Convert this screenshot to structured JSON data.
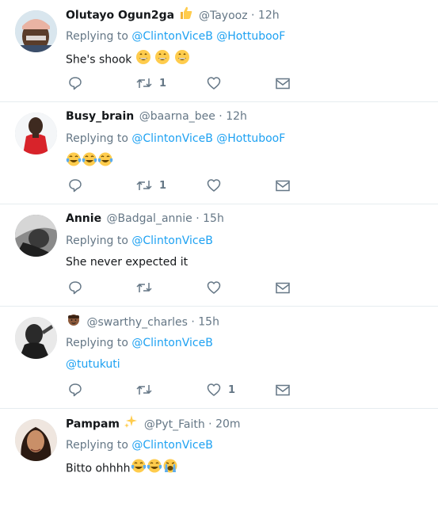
{
  "tweets": [
    {
      "name": "Olutayo Ogun2ga",
      "name_emoji": "thumbs-up",
      "handle": "@Tayooz",
      "dot": "·",
      "time": "12h",
      "replying_prefix": "Replying to ",
      "mentions": [
        "@ClintonViceB",
        "@HottubooF"
      ],
      "text": "She's shook ",
      "text_emojis": [
        "grin",
        "grin",
        "grin"
      ],
      "retweets": "1",
      "likes": ""
    },
    {
      "name": "Busy_brain",
      "handle": "@baarna_bee",
      "dot": "·",
      "time": "12h",
      "replying_prefix": "Replying to ",
      "mentions": [
        "@ClintonViceB",
        "@HottubooF"
      ],
      "text": "",
      "text_emojis": [
        "tears-of-joy",
        "tears-of-joy",
        "tears-of-joy"
      ],
      "retweets": "1",
      "likes": ""
    },
    {
      "name": "Annie",
      "handle": "@Badgal_annie",
      "dot": "·",
      "time": "15h",
      "replying_prefix": "Replying to ",
      "mentions": [
        "@ClintonViceB"
      ],
      "text": "She never expected it",
      "retweets": "",
      "likes": ""
    },
    {
      "name": "",
      "name_emoji": "man-face",
      "handle": "@swarthy_charles",
      "dot": "·",
      "time": "15h",
      "replying_prefix": "Replying to ",
      "mentions": [
        "@ClintonViceB"
      ],
      "text_mention": "@tutukuti",
      "retweets": "",
      "likes": "1"
    },
    {
      "name": "Pampam",
      "name_emoji": "sparkles",
      "handle": "@Pyt_Faith",
      "dot": "·",
      "time": "20m",
      "replying_prefix": "Replying to ",
      "mentions": [
        "@ClintonViceB"
      ],
      "text": "Bitto ohhhh",
      "text_emojis": [
        "tears-of-joy",
        "tears-of-joy",
        "crying"
      ]
    }
  ],
  "colors": {
    "link": "#1da1f2",
    "muted": "#657786",
    "text": "#14171a",
    "divider": "#e6ecf0"
  },
  "icons": {
    "reply": "reply-icon",
    "retweet": "retweet-icon",
    "like": "heart-icon",
    "dm": "envelope-icon"
  }
}
